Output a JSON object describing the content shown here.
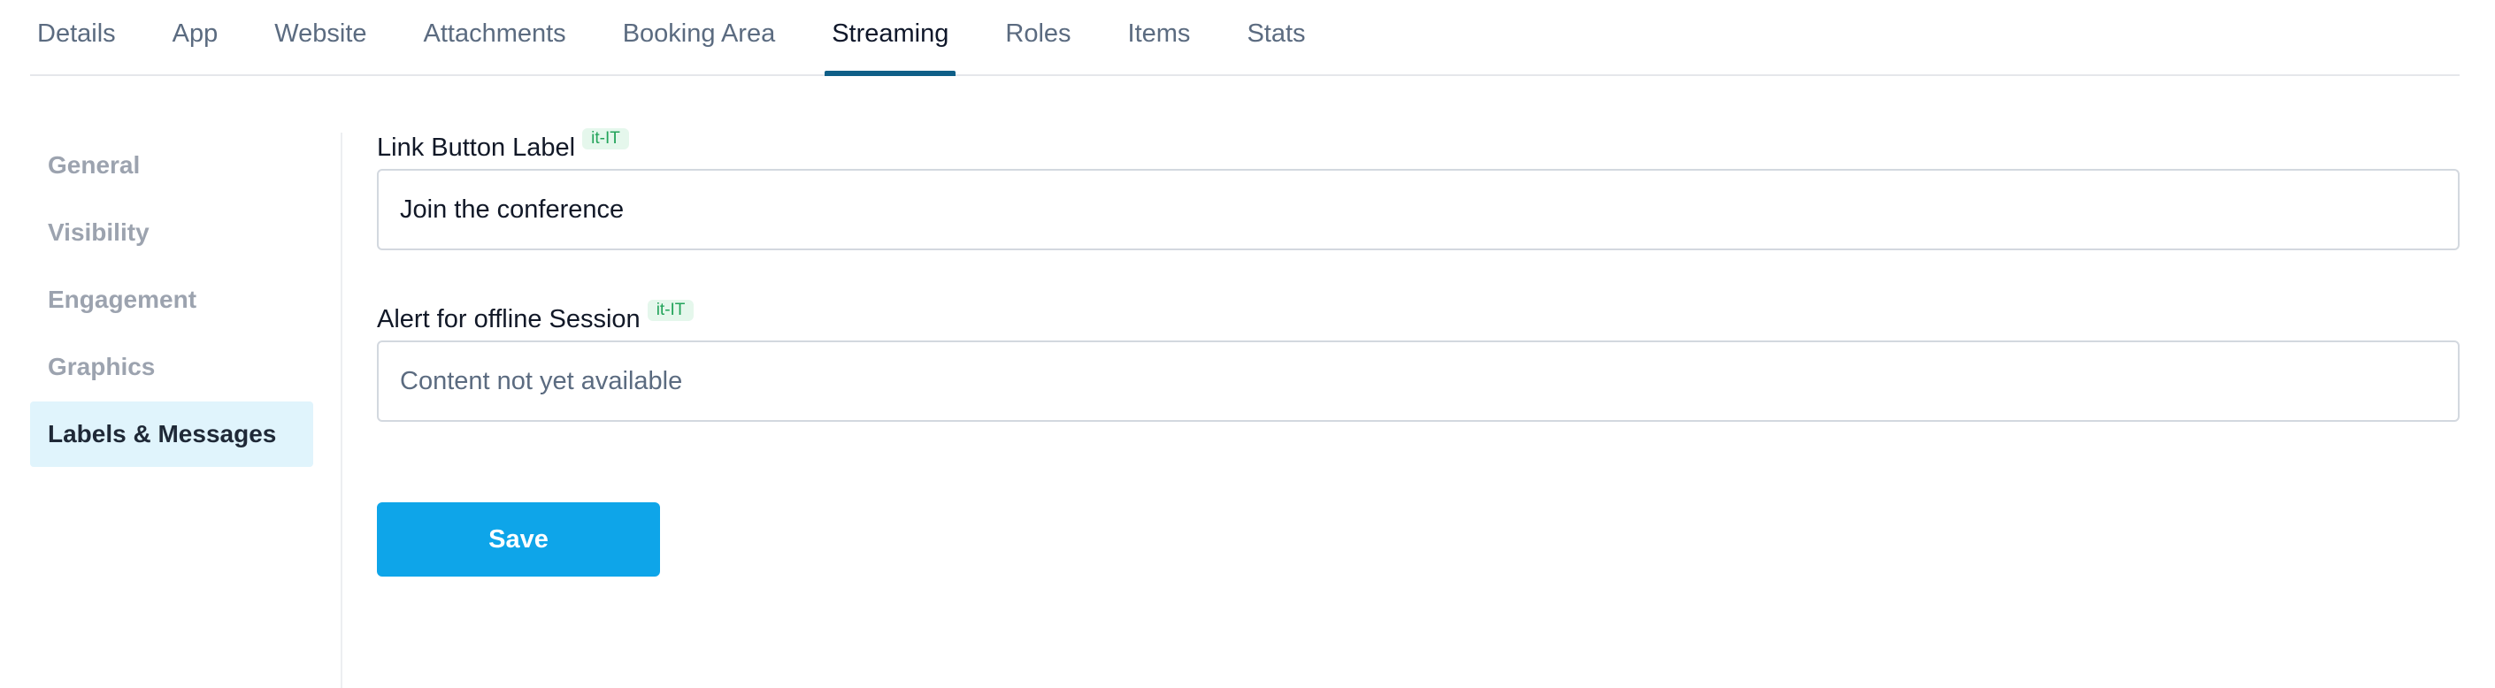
{
  "tabs": [
    {
      "label": "Details"
    },
    {
      "label": "App"
    },
    {
      "label": "Website"
    },
    {
      "label": "Attachments"
    },
    {
      "label": "Booking Area"
    },
    {
      "label": "Streaming"
    },
    {
      "label": "Roles"
    },
    {
      "label": "Items"
    },
    {
      "label": "Stats"
    }
  ],
  "active_tab": "Streaming",
  "sidebar": {
    "items": [
      {
        "label": "General"
      },
      {
        "label": "Visibility"
      },
      {
        "label": "Engagement"
      },
      {
        "label": "Graphics"
      },
      {
        "label": "Labels & Messages"
      }
    ],
    "active": "Labels & Messages"
  },
  "form": {
    "link_button": {
      "label": "Link Button Label",
      "locale": "it-IT",
      "value": "Join the conference"
    },
    "offline_alert": {
      "label": "Alert for offline Session",
      "locale": "it-IT",
      "placeholder": "Content not yet available"
    },
    "save_label": "Save"
  },
  "colors": {
    "accent": "#0ea5e9",
    "tab_indicator": "#0f5f88",
    "active_side_bg": "#e0f4fc",
    "badge_bg": "#e5f7ec",
    "badge_text": "#22a35a"
  }
}
